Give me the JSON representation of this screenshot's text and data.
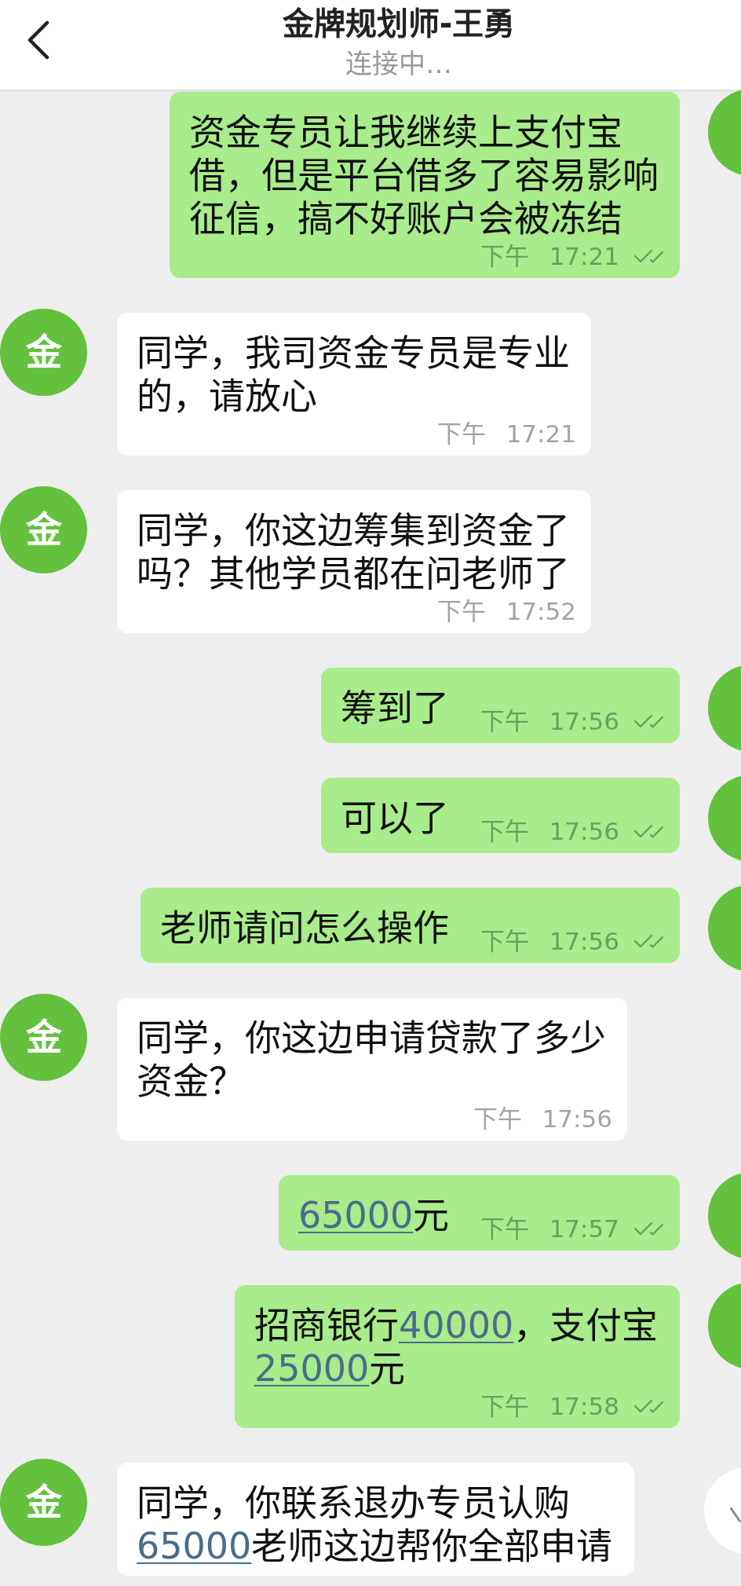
{
  "header": {
    "title": "金牌规划师-王勇",
    "subtitle": "连接中…"
  },
  "messages": [
    {
      "kind": "sent",
      "parts": [
        {
          "kind": "text",
          "text": "资金专员让我继续上支付宝借，但是平台借多了容易影响征信，搞不好账户会被冻结"
        }
      ],
      "time": "下午 17:21",
      "read": true
    },
    {
      "kind": "received",
      "avatar_text": "金",
      "parts": [
        {
          "kind": "text",
          "text": "同学，我司资金专员是专业的，请放心"
        }
      ],
      "time": "下午 17:21"
    },
    {
      "kind": "received",
      "avatar_text": "金",
      "parts": [
        {
          "kind": "text",
          "text": "同学，你这边筹集到资金了吗？其他学员都在问老师了"
        }
      ],
      "time": "下午 17:52"
    },
    {
      "kind": "sent",
      "parts": [
        {
          "kind": "text",
          "text": "筹到了"
        }
      ],
      "time": "下午 17:56",
      "read": true
    },
    {
      "kind": "sent",
      "parts": [
        {
          "kind": "text",
          "text": "可以了"
        }
      ],
      "time": "下午 17:56",
      "read": true
    },
    {
      "kind": "sent",
      "parts": [
        {
          "kind": "text",
          "text": "老师请问怎么操作"
        }
      ],
      "time": "下午 17:56",
      "read": true
    },
    {
      "kind": "received",
      "avatar_text": "金",
      "parts": [
        {
          "kind": "text",
          "text": "同学，你这边申请贷款了多少资金？"
        }
      ],
      "time": "下午 17:56"
    },
    {
      "kind": "sent",
      "parts": [
        {
          "kind": "link",
          "text": "65000"
        },
        {
          "kind": "text",
          "text": "元"
        }
      ],
      "time": "下午 17:57",
      "read": true
    },
    {
      "kind": "sent",
      "parts": [
        {
          "kind": "text",
          "text": "招商银行"
        },
        {
          "kind": "link",
          "text": "40000"
        },
        {
          "kind": "text",
          "text": "，支付宝"
        },
        {
          "kind": "link",
          "text": "25000"
        },
        {
          "kind": "text",
          "text": "元"
        }
      ],
      "time": "下午 17:58",
      "read": true
    },
    {
      "kind": "received",
      "avatar_text": "金",
      "parts": [
        {
          "kind": "text",
          "text": "同学，你联系退办专员认购"
        },
        {
          "kind": "link",
          "text": "65000"
        },
        {
          "kind": "text",
          "text": "老师这边帮你全部申请"
        }
      ]
    }
  ]
}
